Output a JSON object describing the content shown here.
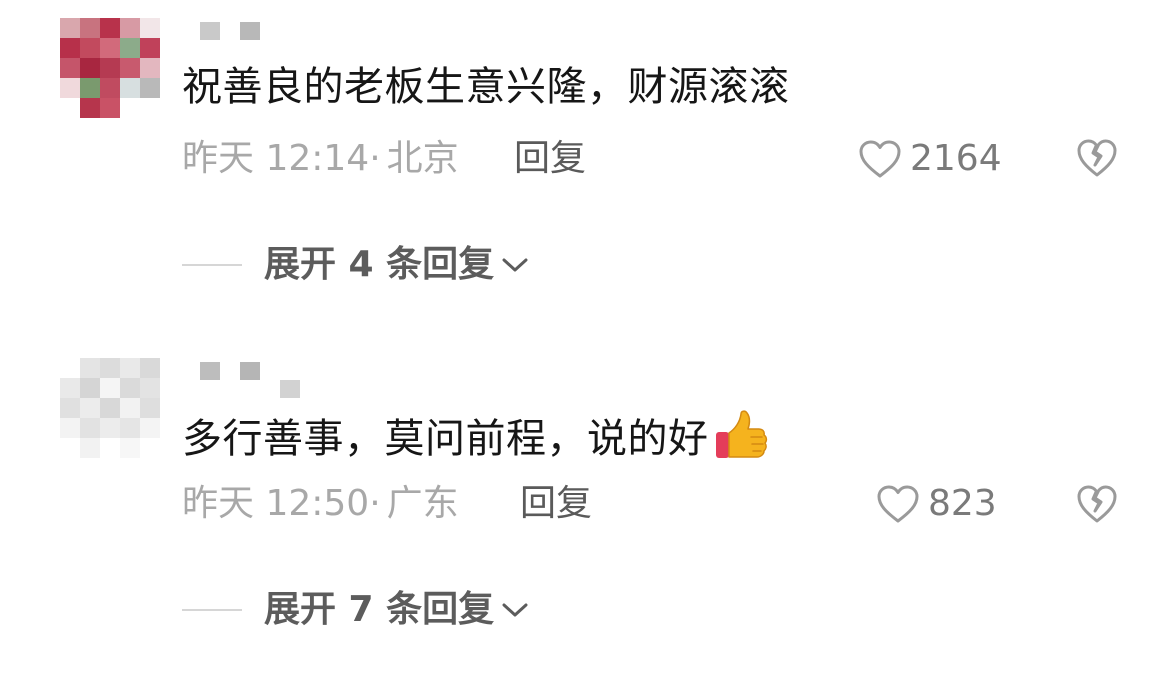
{
  "comments": [
    {
      "text": "祝善良的老板生意兴隆，财源滚滚",
      "time": "昨天 12:14",
      "sep": "·",
      "location": "北京",
      "reply_label": "回复",
      "likes": "2164",
      "expand_label": "展开 4 条回复"
    },
    {
      "text": "多行善事，莫问前程，说的好",
      "time": "昨天 12:50",
      "sep": "·",
      "location": "广东",
      "reply_label": "回复",
      "likes": "823",
      "expand_label": "展开 7 条回复",
      "emoji": "thumbs-up"
    }
  ],
  "colors": {
    "text": "#161616",
    "meta": "#a8a8a8",
    "reply": "#5a5a5a",
    "expand": "#5c5c5c",
    "icon": "#9a9a9a"
  },
  "icons": {
    "like": "heart-outline-icon",
    "dislike": "broken-heart-icon",
    "expand": "chevron-down-icon"
  }
}
